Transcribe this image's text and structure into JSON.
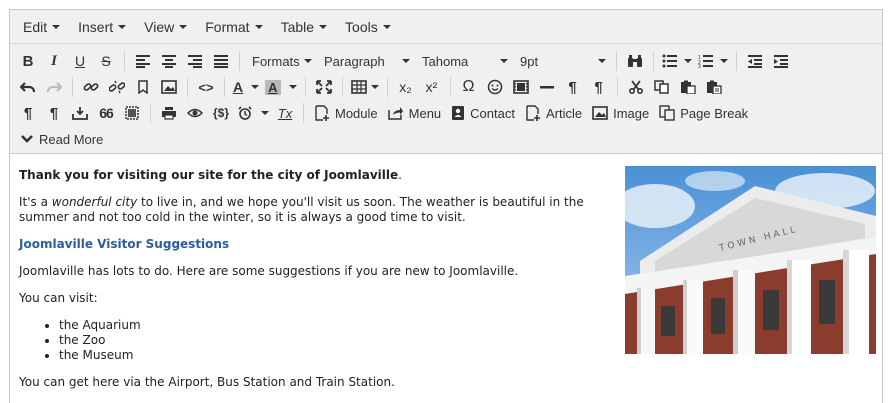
{
  "menubar": {
    "items": [
      "Edit",
      "Insert",
      "View",
      "Format",
      "Table",
      "Tools"
    ]
  },
  "toolbar": {
    "formats_label": "Formats",
    "block_format": "Paragraph",
    "font_family": "Tahoma",
    "font_size": "9pt",
    "module_label": "Module",
    "menu_label": "Menu",
    "contact_label": "Contact",
    "article_label": "Article",
    "image_label": "Image",
    "page_break_label": "Page Break",
    "read_more_label": "Read More",
    "subscript_glyph": "x₂",
    "superscript_glyph": "x²",
    "code_glyph": "<>",
    "omega_glyph": "Ω",
    "variable_glyph": "{$}",
    "pilcrow_glyph": "¶",
    "quote_glyph": "66",
    "text_color_glyph": "A",
    "clear_format_glyph": "Tx"
  },
  "content": {
    "heading_bold": "Thank you for visiting our site for the city of Joomlaville",
    "heading_period": ".",
    "p1_before": "It's a ",
    "p1_em": "wonderful city",
    "p1_after": " to live in, and we hope you'll visit us soon. The weather is beautiful in the summer and not too cold in the winter, so it is always a good time to visit.",
    "subheading": "Joomlaville Visitor Suggestions",
    "p2": "Joomlaville has lots to do. Here are some suggestions if you are new to Joomlaville.",
    "p3": "You can visit:",
    "list": [
      "the Aquarium",
      "the Zoo",
      "the Museum"
    ],
    "p4": "You can get here via the Airport, Bus Station and Train Station.",
    "image_lettering": "TOWN HALL"
  },
  "colors": {
    "link_heading": "#2a5e9e",
    "toolbar_bg": "#f0f0f0",
    "border": "#c8c8c8"
  }
}
